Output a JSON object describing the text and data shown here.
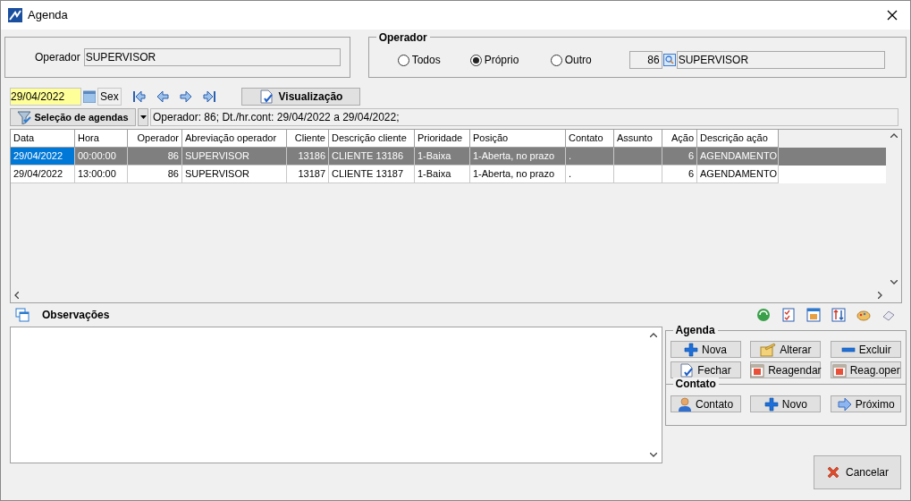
{
  "window": {
    "title": "Agenda"
  },
  "operator_panel": {
    "label": "Operador",
    "value": "SUPERVISOR"
  },
  "operator_group": {
    "title": "Operador",
    "options": [
      {
        "label": "Todos",
        "selected": false
      },
      {
        "label": "Próprio",
        "selected": true
      },
      {
        "label": "Outro",
        "selected": false
      }
    ],
    "code": "86",
    "name": "SUPERVISOR"
  },
  "date_field": {
    "value": "29/04/2022",
    "weekday": "Sex"
  },
  "view_button": "Visualização",
  "selection_button": "Seleção de agendas",
  "filter_text": "Operador: 86; Dt./hr.cont: 29/04/2022 a 29/04/2022;",
  "table": {
    "columns": [
      {
        "label": "Data",
        "right_aligned": false
      },
      {
        "label": "Hora",
        "right_aligned": false
      },
      {
        "label": "Operador",
        "right_aligned": true
      },
      {
        "label": "Abreviação operador",
        "right_aligned": false
      },
      {
        "label": "Cliente",
        "right_aligned": true
      },
      {
        "label": "Descrição cliente",
        "right_aligned": false
      },
      {
        "label": "Prioridade",
        "right_aligned": false
      },
      {
        "label": "Posição",
        "right_aligned": false
      },
      {
        "label": "Contato",
        "right_aligned": false
      },
      {
        "label": "Assunto",
        "right_aligned": false
      },
      {
        "label": "Ação",
        "right_aligned": true
      },
      {
        "label": "Descrição ação",
        "right_aligned": false
      }
    ],
    "rows": [
      {
        "selected": true,
        "cells": [
          "29/04/2022",
          "00:00:00",
          "86",
          "SUPERVISOR",
          "13186",
          "CLIENTE 13186",
          "1-Baixa",
          "1-Aberta, no prazo",
          ".",
          "",
          "6",
          "AGENDAMENTO"
        ]
      },
      {
        "selected": false,
        "cells": [
          "29/04/2022",
          "13:00:00",
          "86",
          "SUPERVISOR",
          "13187",
          "CLIENTE 13187",
          "1-Baixa",
          "1-Aberta, no prazo",
          ".",
          "",
          "6",
          "AGENDAMENTO"
        ]
      }
    ]
  },
  "observations": {
    "title": "Observações"
  },
  "agenda_group": {
    "title": "Agenda",
    "buttons": [
      {
        "label": "Nova",
        "kind": "plus"
      },
      {
        "label": "Alterar",
        "kind": "edit"
      },
      {
        "label": "Excluir",
        "kind": "minus"
      },
      {
        "label": "Fechar",
        "kind": "close"
      },
      {
        "label": "Reagendar",
        "kind": "calendar"
      },
      {
        "label": "Reag.oper",
        "kind": "calendar"
      }
    ]
  },
  "contact_group": {
    "title": "Contato",
    "buttons": [
      {
        "label": "Contato",
        "kind": "person"
      },
      {
        "label": "Novo",
        "kind": "plus"
      },
      {
        "label": "Próximo",
        "kind": "next"
      }
    ]
  },
  "cancel_button": "Cancelar"
}
